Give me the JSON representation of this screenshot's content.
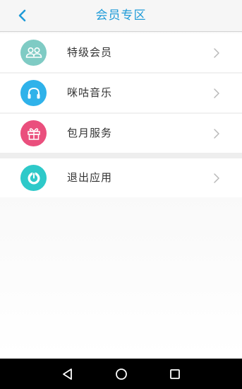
{
  "header": {
    "title": "会员专区"
  },
  "menu": {
    "items": [
      {
        "label": "特级会员",
        "icon": "users-icon",
        "color": "#7fcbc4"
      },
      {
        "label": "咪咕音乐",
        "icon": "headphones-icon",
        "color": "#2fb2ea"
      },
      {
        "label": "包月服务",
        "icon": "gift-icon",
        "color": "#ea4f7d"
      },
      {
        "label": "退出应用",
        "icon": "power-icon",
        "color": "#2ec9c9"
      }
    ]
  },
  "colors": {
    "accent": "#1f9bd8",
    "chevron": "#b9b9b9",
    "navbar": "#000000"
  }
}
